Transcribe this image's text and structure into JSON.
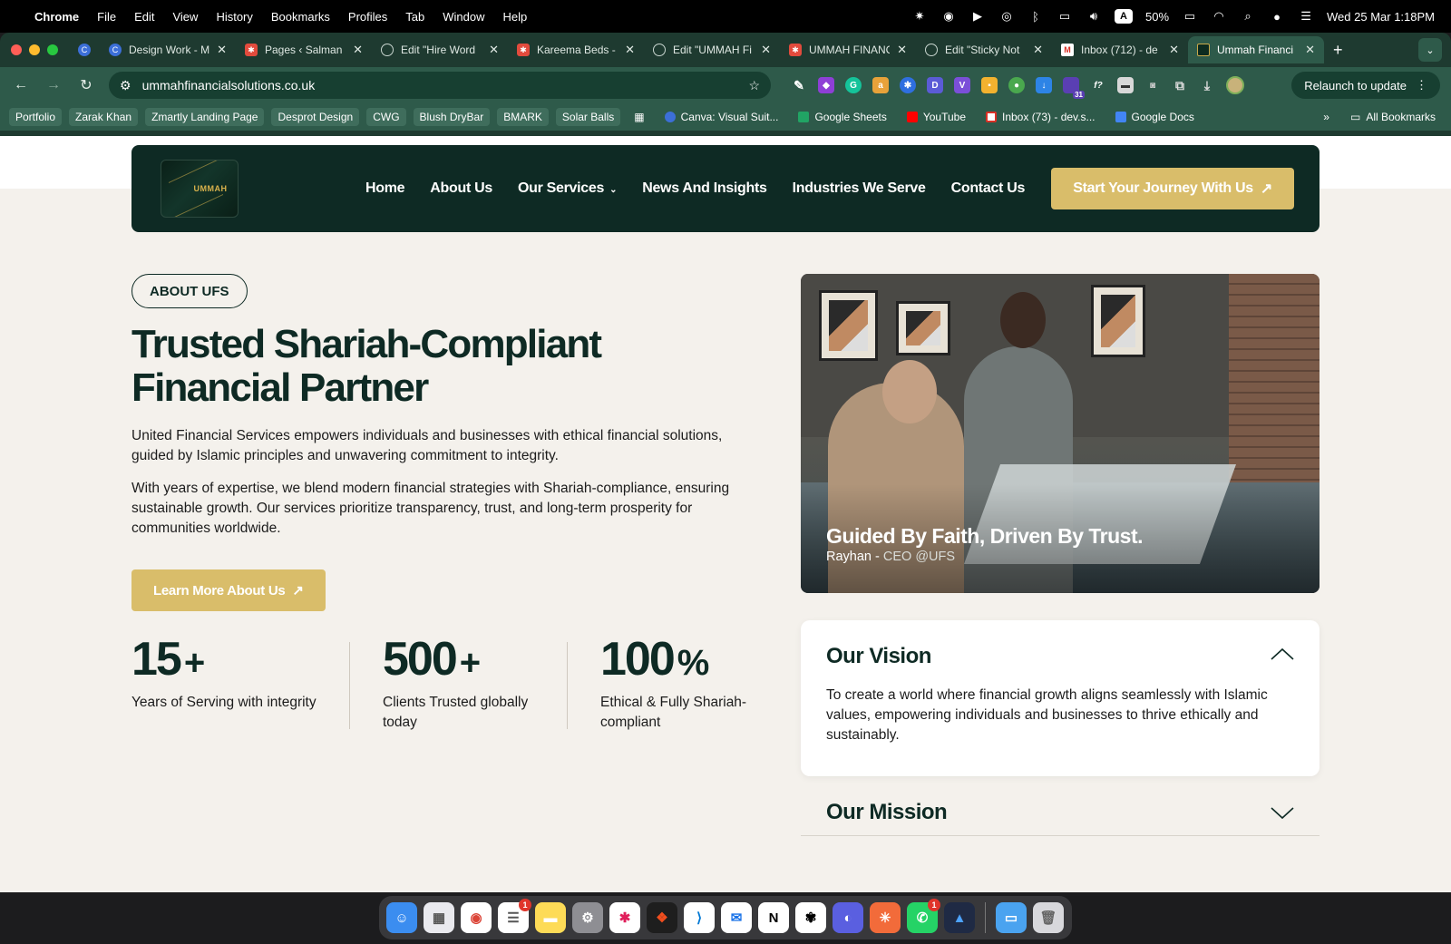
{
  "menubar": {
    "app": "Chrome",
    "items": [
      "File",
      "Edit",
      "View",
      "History",
      "Bookmarks",
      "Profiles",
      "Tab",
      "Window",
      "Help"
    ],
    "battery": "50%",
    "input_source": "A",
    "clock": "Wed 25 Mar  1:18PM"
  },
  "tabs": [
    {
      "label": "Design Work - M",
      "icon": "canva-icon"
    },
    {
      "label": "Pages ‹ Salman",
      "icon": "red-star-icon"
    },
    {
      "label": "Edit \"Hire Word",
      "icon": "globe-icon"
    },
    {
      "label": "Kareema Beds -",
      "icon": "red-star-icon"
    },
    {
      "label": "Edit \"UMMAH Fi",
      "icon": "globe-icon"
    },
    {
      "label": "UMMAH FINANC",
      "icon": "red-star-icon"
    },
    {
      "label": "Edit \"Sticky Not",
      "icon": "globe-icon"
    },
    {
      "label": "Inbox (712) - de",
      "icon": "gmail-icon"
    },
    {
      "label": "Ummah Financi",
      "icon": "ummah-icon"
    }
  ],
  "toolbar": {
    "url": "ummahfinancialsolutions.co.uk",
    "relaunch_label": "Relaunch to update",
    "calendar_badge": "31"
  },
  "bookmarks": {
    "chips": [
      "Portfolio",
      "Zarak Khan",
      "Zmartly Landing Page",
      "Desprot Design",
      "CWG",
      "Blush DryBar",
      "BMARK",
      "Solar Balls"
    ],
    "links": [
      "Canva: Visual Suit...",
      "Google Sheets",
      "YouTube",
      "Inbox (73) - dev.s...",
      "Google Docs"
    ],
    "all_bookmarks": "All Bookmarks"
  },
  "site": {
    "logo_text": "UMMAH",
    "nav": [
      "Home",
      "About Us",
      "Our Services",
      "News And Insights",
      "Industries We Serve",
      "Contact Us"
    ],
    "cta": "Start Your Journey With Us",
    "pill": "ABOUT UFS",
    "headline": "Trusted Shariah-Compliant Financial Partner",
    "para1": "United Financial Services empowers individuals and businesses with ethical financial solutions, guided by Islamic principles and unwavering commitment to integrity.",
    "para2": "With years of expertise, we blend modern financial strategies with Shariah-compliance, ensuring sustainable growth. Our services prioritize transparency, trust, and long-term prosperity for communities worldwide.",
    "learn_more": "Learn More About Us",
    "stats": [
      {
        "num": "15",
        "suffix": "+",
        "label": "Years of Serving with integrity"
      },
      {
        "num": "500",
        "suffix": "+",
        "label": "Clients Trusted globally today"
      },
      {
        "num": "100",
        "suffix": "%",
        "label": "Ethical & Fully Shariah-compliant"
      }
    ],
    "photo_quote": "Guided By Faith, Driven By Trust.",
    "photo_author": "Rayhan - ",
    "photo_role": "CEO @UFS",
    "vision_title": "Our Vision",
    "vision_body": "To create a world where financial growth aligns seamlessly with Islamic values, empowering individuals and businesses to thrive ethically and sustainably.",
    "mission_title": "Our Mission"
  },
  "colors": {
    "brand_dark": "#0e2a24",
    "brand_gold": "#d9bd6a",
    "page_bg": "#f4f1ec",
    "chrome_frame": "#1e3a30"
  },
  "dock_badges": {
    "reminders": "1",
    "whatsapp": "1"
  }
}
